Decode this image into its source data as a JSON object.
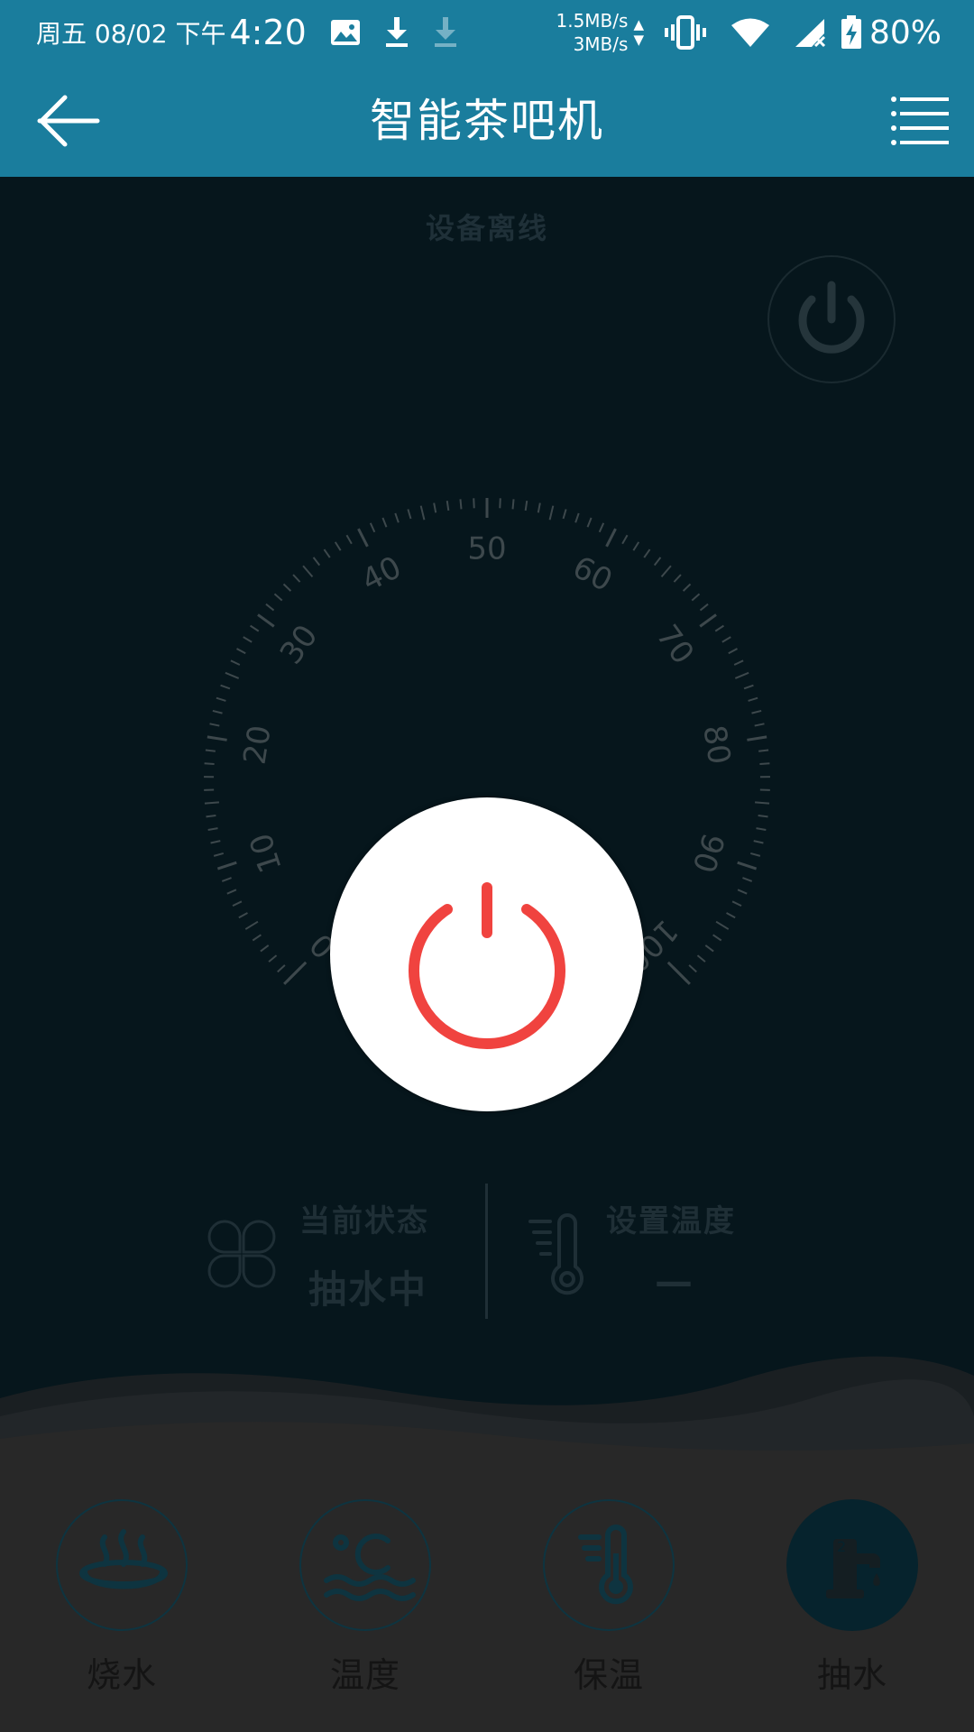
{
  "status_bar": {
    "date": "周五 08/02 下午",
    "time": "4:20",
    "speed_up": "1.5MB/s",
    "speed_down": "3MB/s",
    "arrows": "▲▼",
    "battery": "80%",
    "icons": [
      "image-icon",
      "download-icon",
      "download-faded-icon",
      "vibrate-icon",
      "wifi-icon",
      "signal-off-icon",
      "battery-charging-icon"
    ]
  },
  "app_bar": {
    "title": "智能茶吧机",
    "back_icon": "back-arrow-icon",
    "menu_icon": "menu-list-icon"
  },
  "device": {
    "status": "设备离线"
  },
  "dial": {
    "labels": [
      "0",
      "10",
      "20",
      "30",
      "40",
      "50",
      "60",
      "70",
      "80",
      "90",
      "100"
    ],
    "min": 0,
    "max": 100
  },
  "info": {
    "state_label": "当前状态",
    "state_value": "抽水中",
    "temp_label": "设置温度",
    "temp_value": "—"
  },
  "modes": [
    {
      "label": "烧水",
      "icon": "boil-water-icon",
      "selected": false
    },
    {
      "label": "温度",
      "icon": "temperature-celsius-icon",
      "selected": false
    },
    {
      "label": "保温",
      "icon": "thermometer-icon",
      "selected": false
    },
    {
      "label": "抽水",
      "icon": "water-pump-tap-icon",
      "selected": true
    }
  ],
  "colors": {
    "header": "#1a7d9d",
    "background": "#06161c",
    "power_accent": "#f0433f",
    "bottom_bar": "#282828"
  }
}
